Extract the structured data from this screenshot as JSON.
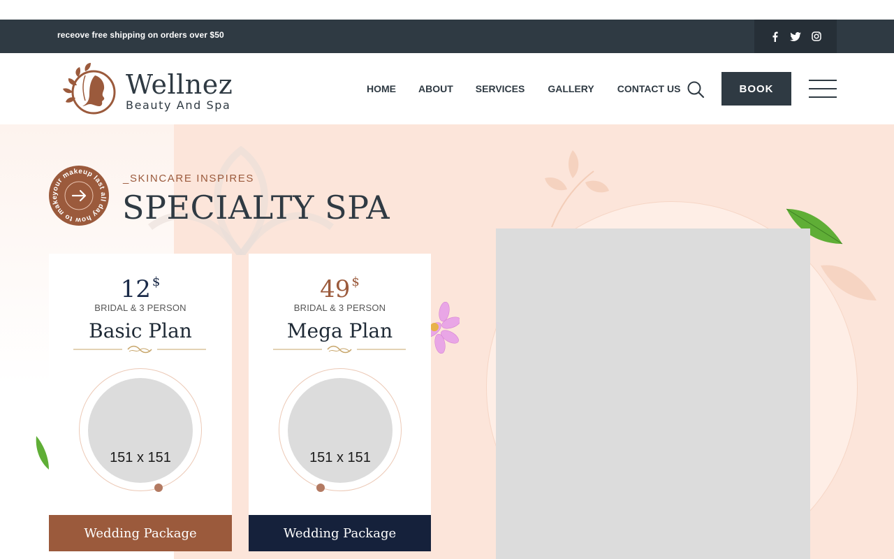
{
  "topbar": {
    "promo_text": "receove free shipping on orders over $50",
    "social": [
      "facebook-icon",
      "twitter-icon",
      "instagram-icon"
    ]
  },
  "header": {
    "brand_name": "Wellnez",
    "brand_tagline": "Beauty And Spa",
    "nav": [
      {
        "label": "HOME"
      },
      {
        "label": "ABOUT"
      },
      {
        "label": "SERVICES"
      },
      {
        "label": "GALLERY"
      },
      {
        "label": "CONTACT US"
      }
    ],
    "book_label": "BOOK"
  },
  "hero": {
    "badge_text": "your makeup last all day how to make",
    "eyebrow": "_SKINCARE INSPIRES",
    "title": "SPECIALTY SPA"
  },
  "plans": [
    {
      "price": "12",
      "currency": "$",
      "subtitle": "BRIDAL & 3 PERSON",
      "name": "Basic Plan",
      "image_label": "151 x 151",
      "button_label": "Wedding Package"
    },
    {
      "price": "49",
      "currency": "$",
      "subtitle": "BRIDAL & 3 PERSON",
      "name": "Mega Plan",
      "image_label": "151 x 151",
      "button_label": "Wedding Package"
    }
  ],
  "colors": {
    "dark": "#2f3a43",
    "brand_brown": "#9b5a3c",
    "navy": "#15213b",
    "peach_bg": "#fce5da"
  }
}
